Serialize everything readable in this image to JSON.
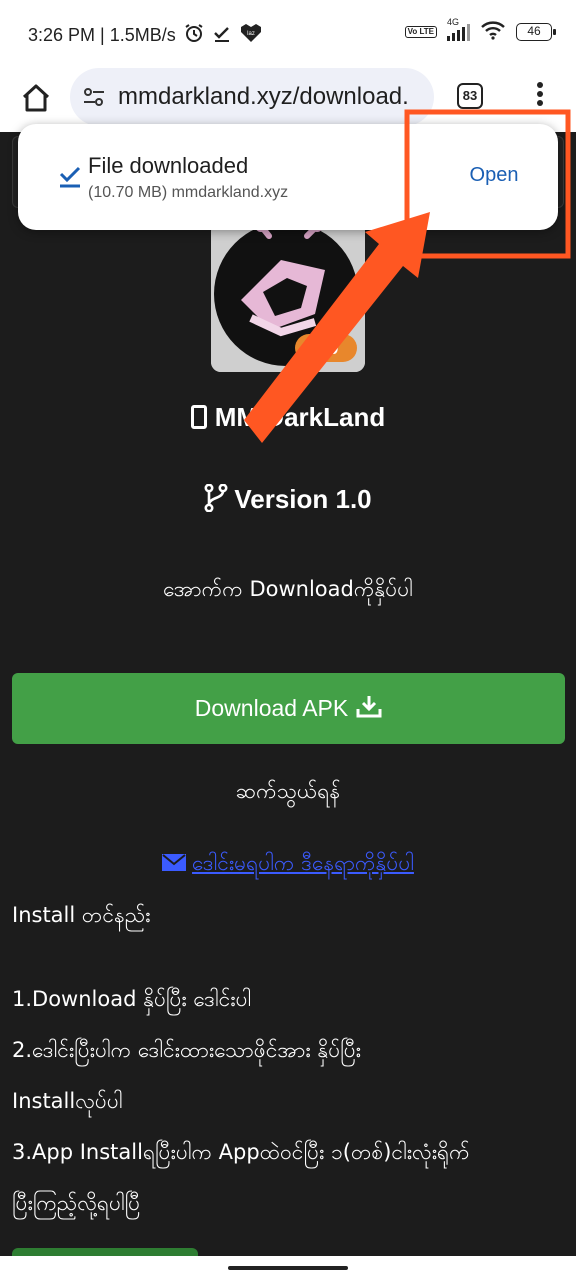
{
  "status_bar": {
    "time_speed": "3:26 PM | 1.5MB/s",
    "network_badge": "Vo LTE",
    "signal_label": "4G",
    "battery": "46",
    "icons": [
      "alarm-icon",
      "check-icon",
      "lazada-icon",
      "volte-icon",
      "signal-icon",
      "wifi-icon",
      "battery-icon"
    ]
  },
  "browser": {
    "url": "mmdarkland.xyz/download.",
    "tab_count": "83",
    "icons": [
      "home-icon",
      "tune-icon",
      "menu-icon"
    ]
  },
  "download_toast": {
    "title": "File downloaded",
    "subtitle": "(10.70 MB) mmdarkland.xyz",
    "action": "Open"
  },
  "page": {
    "app_name": "MM DarkLand",
    "version": "Version 1.0",
    "instruction": "အောက်က Downloadကိုနှိပ်ပါ",
    "download_button": "Download APK",
    "contact_heading": "ဆက်သွယ်ရန်",
    "contact_link": "ဒေါင်းမရပါက ဒီနေရာကိုနှိပ်ပါ",
    "install_heading": "Install တင်နည်း",
    "steps": [
      "1.Download နှိပ်ပြီး ဒေါင်းပါ",
      "2.ဒေါင်းပြီးပါက ဒေါင်းထားသောဖိုင်အား နှိပ်ပြီး",
      "Installလုပ်ပါ",
      "3.App Installရပြီးပါက Appထဲဝင်ပြီး ၁(တစ်)ငါးလုံးရိုက်",
      "ပြီးကြည့်လို့ရပါပြီ"
    ],
    "logo_badge": "1.0"
  },
  "colors": {
    "page_bg": "#1c1c1c",
    "download_button": "#43a047",
    "link": "#3b5bff",
    "highlight": "#ff5722",
    "toast_action": "#1a5fb4"
  }
}
